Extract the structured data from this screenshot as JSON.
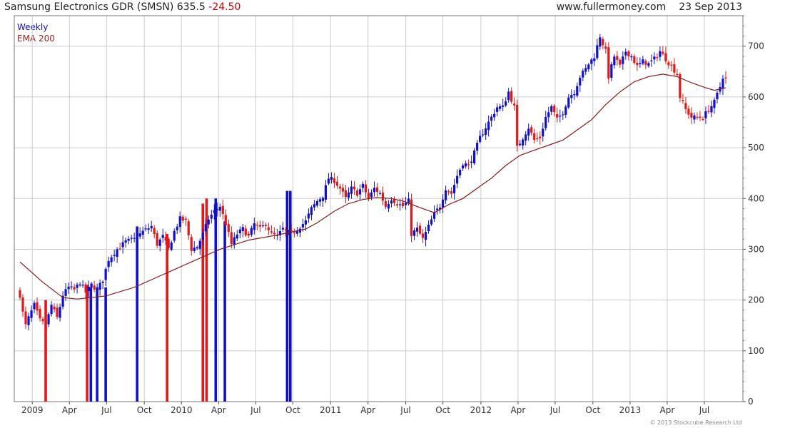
{
  "header": {
    "name": "Samsung Electronics GDR (SMSN)",
    "price": "635.5",
    "change": "-24.50",
    "site": "www.fullermoney.com",
    "date": "23 Sep 2013"
  },
  "footer": {
    "copyright": "© 2013 Stockcube Research Ltd"
  },
  "colors": {
    "up": "#1010c8",
    "down": "#e01818",
    "ema": "#8b1a1a",
    "grid": "#cccccc"
  },
  "chart_data": {
    "type": "candlestick",
    "x_unit": "week index (week 0 = first week of Dec 2008)",
    "ylim": [
      0,
      760
    ],
    "yticks": [
      0,
      100,
      200,
      300,
      400,
      500,
      600,
      700
    ],
    "grid": true,
    "xticks": [
      {
        "label": "2009",
        "week": 4.3
      },
      {
        "label": "Apr",
        "week": 17.3
      },
      {
        "label": "Jul",
        "week": 30.3
      },
      {
        "label": "Oct",
        "week": 43.5
      },
      {
        "label": "2010",
        "week": 56.5
      },
      {
        "label": "Apr",
        "week": 69.5
      },
      {
        "label": "Jul",
        "week": 82.5
      },
      {
        "label": "Oct",
        "week": 95.5
      },
      {
        "label": "2011",
        "week": 108.7
      },
      {
        "label": "Apr",
        "week": 121.8
      },
      {
        "label": "Jul",
        "week": 135
      },
      {
        "label": "Oct",
        "week": 148
      },
      {
        "label": "2012",
        "week": 161.3
      },
      {
        "label": "Apr",
        "week": 174.3
      },
      {
        "label": "Jul",
        "week": 187.3
      },
      {
        "label": "Oct",
        "week": 200.5
      },
      {
        "label": "2013",
        "week": 213.5
      },
      {
        "label": "Apr",
        "week": 226.5
      },
      {
        "label": "Jul",
        "week": 239.5
      }
    ],
    "legend": [
      "Weekly",
      "EMA 200"
    ],
    "anchors": [
      [
        0,
        210
      ],
      [
        1,
        175
      ],
      [
        2,
        150
      ],
      [
        3,
        165
      ],
      [
        5,
        190
      ],
      [
        7,
        160
      ],
      [
        9,
        150
      ],
      [
        11,
        190
      ],
      [
        13,
        165
      ],
      [
        15,
        210
      ],
      [
        17,
        225
      ],
      [
        19,
        220
      ],
      [
        21,
        235
      ],
      [
        23,
        215
      ],
      [
        25,
        230
      ],
      [
        27,
        220
      ],
      [
        29,
        240
      ],
      [
        31,
        280
      ],
      [
        34,
        300
      ],
      [
        37,
        315
      ],
      [
        40,
        320
      ],
      [
        43,
        335
      ],
      [
        46,
        345
      ],
      [
        48,
        310
      ],
      [
        50,
        325
      ],
      [
        52,
        300
      ],
      [
        54,
        335
      ],
      [
        56,
        360
      ],
      [
        58,
        355
      ],
      [
        60,
        300
      ],
      [
        62,
        305
      ],
      [
        64,
        330
      ],
      [
        66,
        360
      ],
      [
        68,
        375
      ],
      [
        70,
        385
      ],
      [
        72,
        350
      ],
      [
        74,
        310
      ],
      [
        76,
        330
      ],
      [
        78,
        340
      ],
      [
        80,
        325
      ],
      [
        82,
        350
      ],
      [
        84,
        340
      ],
      [
        86,
        350
      ],
      [
        88,
        330
      ],
      [
        90,
        325
      ],
      [
        92,
        340
      ],
      [
        94,
        330
      ],
      [
        96,
        335
      ],
      [
        98,
        345
      ],
      [
        100,
        355
      ],
      [
        102,
        380
      ],
      [
        104,
        395
      ],
      [
        106,
        405
      ],
      [
        108,
        440
      ],
      [
        110,
        435
      ],
      [
        112,
        420
      ],
      [
        114,
        400
      ],
      [
        116,
        420
      ],
      [
        118,
        410
      ],
      [
        120,
        425
      ],
      [
        122,
        400
      ],
      [
        124,
        420
      ],
      [
        126,
        410
      ],
      [
        128,
        385
      ],
      [
        130,
        400
      ],
      [
        132,
        390
      ],
      [
        134,
        385
      ],
      [
        136,
        395
      ],
      [
        137,
        330
      ],
      [
        139,
        340
      ],
      [
        141,
        320
      ],
      [
        143,
        345
      ],
      [
        145,
        370
      ],
      [
        147,
        385
      ],
      [
        149,
        420
      ],
      [
        151,
        410
      ],
      [
        153,
        445
      ],
      [
        155,
        470
      ],
      [
        157,
        465
      ],
      [
        159,
        490
      ],
      [
        161,
        520
      ],
      [
        163,
        540
      ],
      [
        165,
        560
      ],
      [
        167,
        580
      ],
      [
        169,
        580
      ],
      [
        171,
        610
      ],
      [
        173,
        580
      ],
      [
        174,
        500
      ],
      [
        176,
        520
      ],
      [
        178,
        540
      ],
      [
        180,
        515
      ],
      [
        182,
        520
      ],
      [
        184,
        560
      ],
      [
        186,
        580
      ],
      [
        188,
        555
      ],
      [
        190,
        570
      ],
      [
        192,
        600
      ],
      [
        194,
        610
      ],
      [
        196,
        640
      ],
      [
        198,
        655
      ],
      [
        199,
        665
      ],
      [
        201,
        680
      ],
      [
        203,
        720
      ],
      [
        205,
        690
      ],
      [
        206,
        640
      ],
      [
        208,
        680
      ],
      [
        210,
        660
      ],
      [
        212,
        690
      ],
      [
        214,
        680
      ],
      [
        216,
        660
      ],
      [
        218,
        670
      ],
      [
        220,
        665
      ],
      [
        222,
        675
      ],
      [
        224,
        690
      ],
      [
        226,
        675
      ],
      [
        228,
        660
      ],
      [
        230,
        645
      ],
      [
        231,
        600
      ],
      [
        233,
        575
      ],
      [
        235,
        560
      ],
      [
        237,
        560
      ],
      [
        239,
        560
      ],
      [
        241,
        575
      ],
      [
        243,
        590
      ],
      [
        245,
        620
      ],
      [
        246,
        640
      ],
      [
        247,
        635.5
      ]
    ],
    "ema200": [
      [
        0,
        275
      ],
      [
        8,
        235
      ],
      [
        15,
        205
      ],
      [
        20,
        202
      ],
      [
        30,
        208
      ],
      [
        40,
        225
      ],
      [
        50,
        250
      ],
      [
        60,
        275
      ],
      [
        70,
        300
      ],
      [
        80,
        318
      ],
      [
        90,
        328
      ],
      [
        100,
        340
      ],
      [
        104,
        352
      ],
      [
        110,
        375
      ],
      [
        115,
        390
      ],
      [
        120,
        398
      ],
      [
        125,
        402
      ],
      [
        130,
        400
      ],
      [
        134,
        395
      ],
      [
        140,
        382
      ],
      [
        145,
        372
      ],
      [
        150,
        388
      ],
      [
        155,
        400
      ],
      [
        160,
        420
      ],
      [
        165,
        440
      ],
      [
        170,
        465
      ],
      [
        175,
        485
      ],
      [
        180,
        495
      ],
      [
        185,
        505
      ],
      [
        190,
        515
      ],
      [
        195,
        535
      ],
      [
        200,
        555
      ],
      [
        205,
        585
      ],
      [
        210,
        610
      ],
      [
        215,
        630
      ],
      [
        220,
        640
      ],
      [
        225,
        645
      ],
      [
        230,
        640
      ],
      [
        235,
        628
      ],
      [
        240,
        618
      ],
      [
        243,
        613
      ],
      [
        247,
        618
      ]
    ],
    "volume_bars": [
      {
        "week": 9,
        "value": 200,
        "color": "down"
      },
      {
        "week": 23.5,
        "value": 230,
        "color": "down"
      },
      {
        "week": 24.8,
        "value": 225,
        "color": "up"
      },
      {
        "week": 27,
        "value": 225,
        "color": "up"
      },
      {
        "week": 30,
        "value": 225,
        "color": "up"
      },
      {
        "week": 41,
        "value": 345,
        "color": "up"
      },
      {
        "week": 51.5,
        "value": 330,
        "color": "down"
      },
      {
        "week": 64,
        "value": 390,
        "color": "down"
      },
      {
        "week": 65.3,
        "value": 400,
        "color": "down"
      },
      {
        "week": 68.5,
        "value": 400,
        "color": "up"
      },
      {
        "week": 71.7,
        "value": 355,
        "color": "up"
      },
      {
        "week": 93.5,
        "value": 415,
        "color": "up"
      },
      {
        "week": 94.6,
        "value": 415,
        "color": "up"
      }
    ]
  }
}
